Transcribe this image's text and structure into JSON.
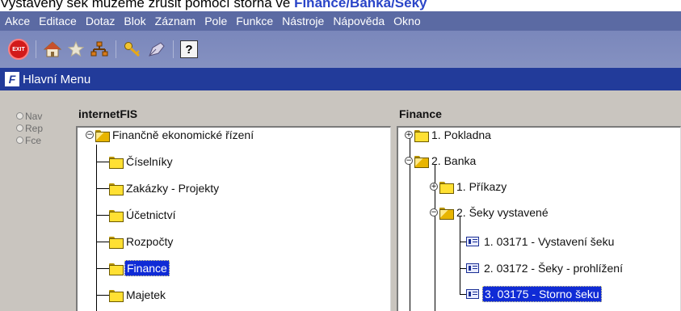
{
  "caption": {
    "text": "Vystavený šek můžeme zrušit pomocí storna ve ",
    "highlight": "Finance/Banka/Šeky"
  },
  "menu": [
    "Akce",
    "Editace",
    "Dotaz",
    "Blok",
    "Záznam",
    "Pole",
    "Funkce",
    "Nástroje",
    "Nápověda",
    "Okno"
  ],
  "toolbar": {
    "exit_label": "EXIT",
    "help_label": "?"
  },
  "window": {
    "title": "Hlavní Menu",
    "icon_letter": "F"
  },
  "radios": [
    {
      "label": "Nav"
    },
    {
      "label": "Rep"
    },
    {
      "label": "Fce"
    }
  ],
  "left_panel": {
    "title": "internetFIS",
    "root": "Finančně ekonomické řízení",
    "items": [
      "Číselníky",
      "Zakázky - Projekty",
      "Účetnictví",
      "Rozpočty",
      "Finance",
      "Majetek"
    ],
    "selected": "Finance"
  },
  "right_panel": {
    "title": "Finance",
    "pokladna": "1. Pokladna",
    "banka": "2. Banka",
    "prikazy": "1. Příkazy",
    "seky": "2. Šeky vystavené",
    "forms": [
      "1. 03171 - Vystavení šeku",
      "2. 03172 - Šeky - prohlížení",
      "3. 03175 - Storno šeku"
    ],
    "selected": "3. 03175 - Storno šeku"
  },
  "colors": {
    "menubar": "#5b6aa3",
    "titlebar": "#223b9a",
    "selection": "#0f2bd6",
    "highlight_text": "#2a45c8"
  }
}
